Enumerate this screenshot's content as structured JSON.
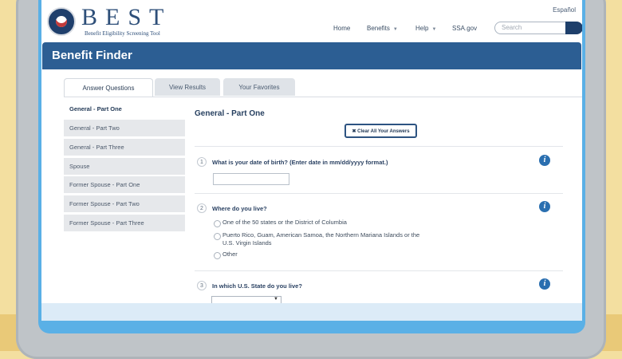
{
  "header": {
    "espanol": "Español",
    "logo_title": "BEST",
    "logo_subtitle": "Benefit Eligibility Screening Tool",
    "nav": [
      {
        "label": "Home"
      },
      {
        "label": "Benefits"
      },
      {
        "label": "Help"
      },
      {
        "label": "SSA.gov"
      }
    ],
    "search_placeholder": "Search"
  },
  "banner": {
    "title": "Benefit Finder"
  },
  "tabs": [
    {
      "label": "Answer Questions",
      "active": true
    },
    {
      "label": "View Results",
      "active": false
    },
    {
      "label": "Your Favorites",
      "active": false
    }
  ],
  "sidebar": [
    {
      "label": "General - Part One",
      "active": true
    },
    {
      "label": "General - Part Two",
      "active": false
    },
    {
      "label": "General - Part Three",
      "active": false
    },
    {
      "label": "Spouse",
      "active": false
    },
    {
      "label": "Former Spouse - Part One",
      "active": false
    },
    {
      "label": "Former Spouse - Part Two",
      "active": false
    },
    {
      "label": "Former Spouse - Part Three",
      "active": false
    }
  ],
  "main": {
    "section_title": "General - Part One",
    "clear_button": "Clear All Your Answers",
    "questions": [
      {
        "number": "1",
        "text": "What is your date of birth? (Enter date in mm/dd/yyyy format.)",
        "input_value": ""
      },
      {
        "number": "2",
        "text": "Where do you live?",
        "options": [
          "One of the 50 states or the District of Columbia",
          "Puerto Rico, Guam, American Samoa, the Northern Mariana Islands or the U.S. Virgin Islands",
          "Other"
        ]
      },
      {
        "number": "3",
        "text": "In which U.S. State do you live?",
        "select_value": ""
      }
    ]
  },
  "colors": {
    "banner": "#2c5e93",
    "info_icon": "#2a6fb0",
    "screen_frame": "#5ab0e6",
    "wall": "#f3dfa0"
  }
}
